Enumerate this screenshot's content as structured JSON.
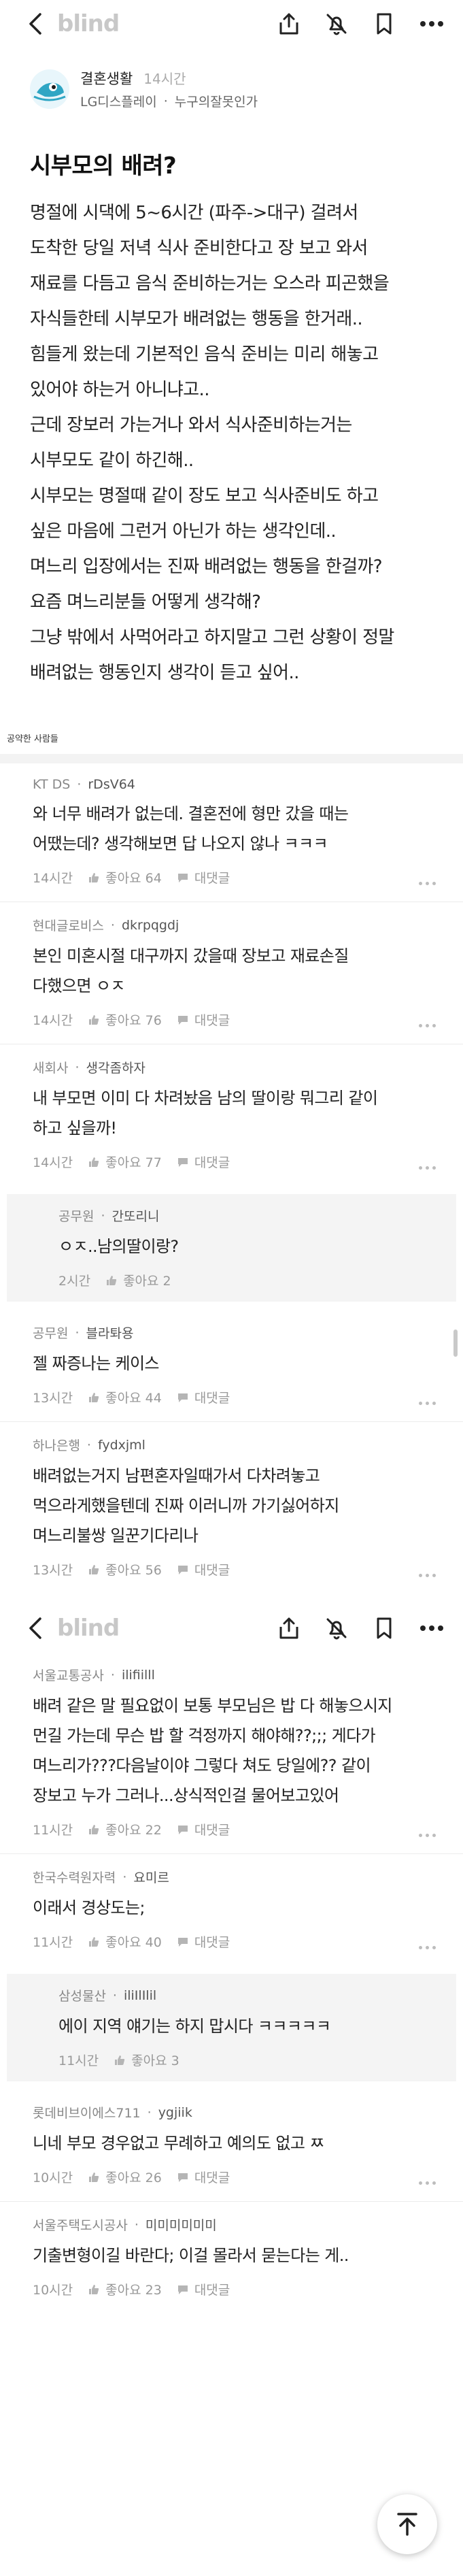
{
  "app": {
    "logo": "blind"
  },
  "post": {
    "author": "결혼생활",
    "time": "14시간",
    "company": "LG디스플레이",
    "topic": "누구의잘못인가",
    "title": "시부모의 배려?",
    "body": [
      "명절에 시댁에 5~6시간 (파주->대구) 걸려서",
      "도착한 당일 저녁 식사 준비한다고 장 보고 와서",
      "재료를 다듬고 음식 준비하는거는 오스라 피곤했을",
      "자식들한테 시부모가 배려없는 행동을 한거래..",
      "힘들게 왔는데 기본적인 음식 준비는 미리 해놓고",
      "있어야 하는거 아니냐고..",
      "근데 장보러 가는거나 와서 식사준비하는거는",
      "시부모도 같이 하긴해..",
      "시부모는 명절때 같이 장도 보고 식사준비도 하고",
      "싶은 마음에 그런거 아닌가 하는 생각인데..",
      "며느리 입장에서는 진짜 배려없는 행동을 한걸까?",
      "요즘 며느리분들 어떻게 생각해?",
      "그냥 밖에서 사먹어라고 하지말고 그런 상황이 정말",
      "배려없는 행동인지 생각이 듣고 싶어.."
    ]
  },
  "related_label": "공약한 사람들",
  "comments_a": [
    {
      "company": "KT DS",
      "nick": "rDsV64",
      "lines": [
        "와 너무 배려가 없는데. 결혼전에 형만 갔을 때는",
        "어땠는데? 생각해보면 답 나오지 않나 ㅋㅋㅋ"
      ],
      "time": "14시간",
      "likes": "좋아요 64",
      "reply_label": "대댓글"
    },
    {
      "company": "현대글로비스",
      "nick": "dkrpqgdj",
      "lines": [
        "본인 미혼시절 대구까지 갔을때 장보고 재료손질",
        "다했으면 ㅇㅈ"
      ],
      "time": "14시간",
      "likes": "좋아요 76",
      "reply_label": "대댓글"
    },
    {
      "company": "새회사",
      "nick": "생각좀하자",
      "lines": [
        "내 부모면 이미 다 차려놨음 남의 딸이랑 뭐그리 같이",
        "하고 싶을까!"
      ],
      "time": "14시간",
      "likes": "좋아요 77",
      "reply_label": "대댓글"
    }
  ],
  "reply_a": {
    "company": "공무원",
    "nick": "간또리니",
    "lines": [
      "ㅇㅈ..남의딸이랑?"
    ],
    "time": "2시간",
    "likes": "좋아요 2"
  },
  "comments_b": [
    {
      "company": "공무원",
      "nick": "블라톼용",
      "lines": [
        "젤 짜증나는 케이스"
      ],
      "time": "13시간",
      "likes": "좋아요 44",
      "reply_label": "대댓글"
    },
    {
      "company": "하나은행",
      "nick": "fydxjml",
      "lines": [
        "배려없는거지 남편혼자일때가서 다차려놓고",
        "먹으라게했을텐데 진짜 이러니까 가기싫어하지",
        "며느리불쌍 일꾼기다리나"
      ],
      "time": "13시간",
      "likes": "좋아요 56",
      "reply_label": "대댓글"
    }
  ],
  "comments_c": [
    {
      "company": "서울교통공사",
      "nick": "ilifiilll",
      "lines": [
        "배려 같은 말 필요없이 보통 부모님은 밥 다 해놓으시지",
        "먼길 가는데 무슨 밥 할 걱정까지 해야해??;;; 게다가",
        "며느리가???다음날이야 그렇다 쳐도 당일에?? 같이",
        "장보고 누가 그러나...상식적인걸 물어보고있어"
      ],
      "time": "11시간",
      "likes": "좋아요 22",
      "reply_label": "대댓글"
    },
    {
      "company": "한국수력원자력",
      "nick": "요미르",
      "lines": [
        "이래서 경상도는;"
      ],
      "time": "11시간",
      "likes": "좋아요 40",
      "reply_label": "대댓글"
    }
  ],
  "reply_b": {
    "company": "삼성물산",
    "nick": "iliIlIlil",
    "lines": [
      "에이 지역 얘기는 하지 맙시다 ㅋㅋㅋㅋㅋ"
    ],
    "time": "11시간",
    "likes": "좋아요 3"
  },
  "comments_d": [
    {
      "company": "롯데비브이에스711",
      "nick": "ygjiik",
      "lines": [
        "니네 부모 경우없고 무례하고 예의도 없고 ㅉ"
      ],
      "time": "10시간",
      "likes": "좋아요 26",
      "reply_label": "대댓글"
    },
    {
      "company": "서울주택도시공사",
      "nick": "미미미미미미",
      "lines": [
        "기출변형이길 바란다; 이걸 몰라서 묻는다는 게.."
      ],
      "time": "10시간",
      "likes": "좋아요 23",
      "reply_label": "대댓글"
    }
  ]
}
